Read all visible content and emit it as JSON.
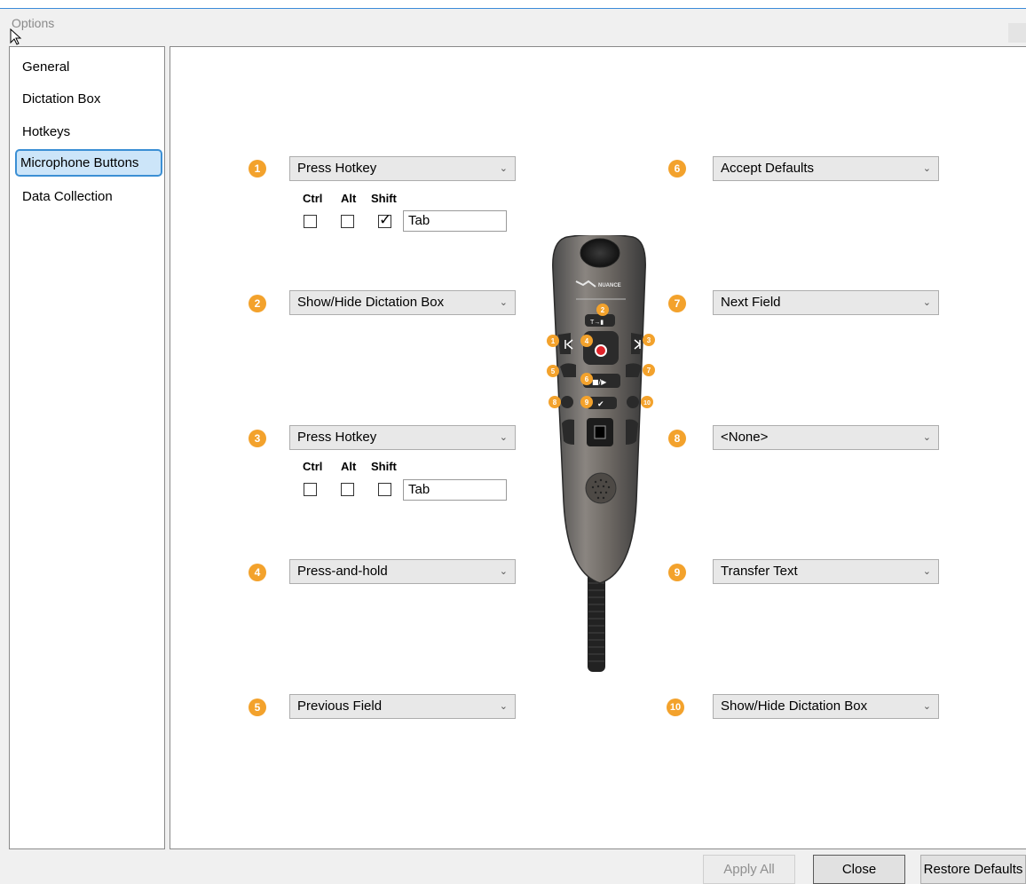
{
  "window": {
    "title": "Options"
  },
  "nav": {
    "items": [
      {
        "label": "General",
        "selected": false
      },
      {
        "label": "Dictation Box",
        "selected": false
      },
      {
        "label": "Hotkeys",
        "selected": false
      },
      {
        "label": "Microphone Buttons",
        "selected": true
      },
      {
        "label": "Data Collection",
        "selected": false
      }
    ]
  },
  "modifiers": {
    "ctrl": "Ctrl",
    "alt": "Alt",
    "shift": "Shift"
  },
  "buttons": [
    {
      "number": "1",
      "action": "Press Hotkey",
      "hotkey": {
        "ctrl": false,
        "alt": false,
        "shift": true,
        "key": "Tab"
      }
    },
    {
      "number": "2",
      "action": "Show/Hide Dictation Box"
    },
    {
      "number": "3",
      "action": "Press Hotkey",
      "hotkey": {
        "ctrl": false,
        "alt": false,
        "shift": false,
        "key": "Tab"
      }
    },
    {
      "number": "4",
      "action": "Press-and-hold"
    },
    {
      "number": "5",
      "action": "Previous Field"
    },
    {
      "number": "6",
      "action": "Accept Defaults"
    },
    {
      "number": "7",
      "action": "Next Field"
    },
    {
      "number": "8",
      "action": "<None>"
    },
    {
      "number": "9",
      "action": "Transfer Text"
    },
    {
      "number": "10",
      "action": "Show/Hide Dictation Box"
    }
  ],
  "device": {
    "brand": "NUANCE",
    "button_glyphs": {
      "transfer": "T→▮",
      "play_stop": "■/▶",
      "check": "✔"
    }
  },
  "footer": {
    "apply_all": "Apply All",
    "close": "Close",
    "restore_defaults": "Restore Defaults"
  },
  "colors": {
    "badge": "#f3a22c",
    "selected_nav_bg": "#cce5f9",
    "selected_nav_border": "#3b8fd4",
    "record_red": "#e0242a"
  },
  "icons": {
    "dropdown": "chevron-down-icon",
    "checkbox_checked": "checkmark-icon"
  }
}
